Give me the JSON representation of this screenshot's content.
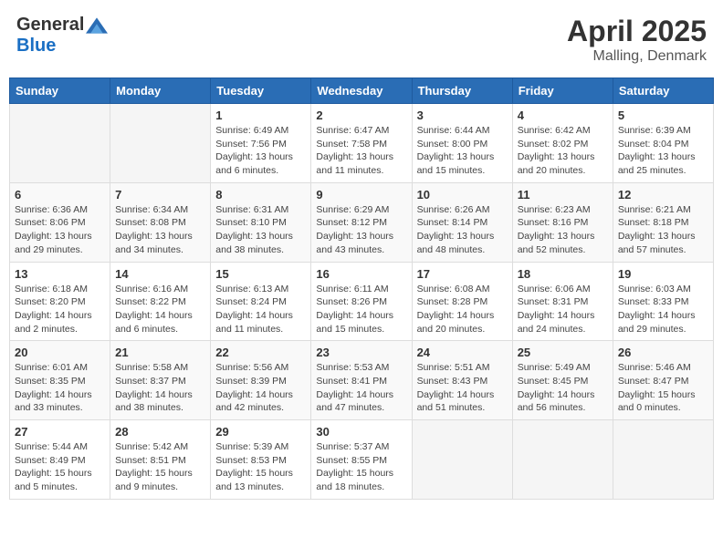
{
  "header": {
    "logo_general": "General",
    "logo_blue": "Blue",
    "month_year": "April 2025",
    "location": "Malling, Denmark"
  },
  "days_of_week": [
    "Sunday",
    "Monday",
    "Tuesday",
    "Wednesday",
    "Thursday",
    "Friday",
    "Saturday"
  ],
  "weeks": [
    [
      {
        "day": "",
        "info": ""
      },
      {
        "day": "",
        "info": ""
      },
      {
        "day": "1",
        "info": "Sunrise: 6:49 AM\nSunset: 7:56 PM\nDaylight: 13 hours and 6 minutes."
      },
      {
        "day": "2",
        "info": "Sunrise: 6:47 AM\nSunset: 7:58 PM\nDaylight: 13 hours and 11 minutes."
      },
      {
        "day": "3",
        "info": "Sunrise: 6:44 AM\nSunset: 8:00 PM\nDaylight: 13 hours and 15 minutes."
      },
      {
        "day": "4",
        "info": "Sunrise: 6:42 AM\nSunset: 8:02 PM\nDaylight: 13 hours and 20 minutes."
      },
      {
        "day": "5",
        "info": "Sunrise: 6:39 AM\nSunset: 8:04 PM\nDaylight: 13 hours and 25 minutes."
      }
    ],
    [
      {
        "day": "6",
        "info": "Sunrise: 6:36 AM\nSunset: 8:06 PM\nDaylight: 13 hours and 29 minutes."
      },
      {
        "day": "7",
        "info": "Sunrise: 6:34 AM\nSunset: 8:08 PM\nDaylight: 13 hours and 34 minutes."
      },
      {
        "day": "8",
        "info": "Sunrise: 6:31 AM\nSunset: 8:10 PM\nDaylight: 13 hours and 38 minutes."
      },
      {
        "day": "9",
        "info": "Sunrise: 6:29 AM\nSunset: 8:12 PM\nDaylight: 13 hours and 43 minutes."
      },
      {
        "day": "10",
        "info": "Sunrise: 6:26 AM\nSunset: 8:14 PM\nDaylight: 13 hours and 48 minutes."
      },
      {
        "day": "11",
        "info": "Sunrise: 6:23 AM\nSunset: 8:16 PM\nDaylight: 13 hours and 52 minutes."
      },
      {
        "day": "12",
        "info": "Sunrise: 6:21 AM\nSunset: 8:18 PM\nDaylight: 13 hours and 57 minutes."
      }
    ],
    [
      {
        "day": "13",
        "info": "Sunrise: 6:18 AM\nSunset: 8:20 PM\nDaylight: 14 hours and 2 minutes."
      },
      {
        "day": "14",
        "info": "Sunrise: 6:16 AM\nSunset: 8:22 PM\nDaylight: 14 hours and 6 minutes."
      },
      {
        "day": "15",
        "info": "Sunrise: 6:13 AM\nSunset: 8:24 PM\nDaylight: 14 hours and 11 minutes."
      },
      {
        "day": "16",
        "info": "Sunrise: 6:11 AM\nSunset: 8:26 PM\nDaylight: 14 hours and 15 minutes."
      },
      {
        "day": "17",
        "info": "Sunrise: 6:08 AM\nSunset: 8:28 PM\nDaylight: 14 hours and 20 minutes."
      },
      {
        "day": "18",
        "info": "Sunrise: 6:06 AM\nSunset: 8:31 PM\nDaylight: 14 hours and 24 minutes."
      },
      {
        "day": "19",
        "info": "Sunrise: 6:03 AM\nSunset: 8:33 PM\nDaylight: 14 hours and 29 minutes."
      }
    ],
    [
      {
        "day": "20",
        "info": "Sunrise: 6:01 AM\nSunset: 8:35 PM\nDaylight: 14 hours and 33 minutes."
      },
      {
        "day": "21",
        "info": "Sunrise: 5:58 AM\nSunset: 8:37 PM\nDaylight: 14 hours and 38 minutes."
      },
      {
        "day": "22",
        "info": "Sunrise: 5:56 AM\nSunset: 8:39 PM\nDaylight: 14 hours and 42 minutes."
      },
      {
        "day": "23",
        "info": "Sunrise: 5:53 AM\nSunset: 8:41 PM\nDaylight: 14 hours and 47 minutes."
      },
      {
        "day": "24",
        "info": "Sunrise: 5:51 AM\nSunset: 8:43 PM\nDaylight: 14 hours and 51 minutes."
      },
      {
        "day": "25",
        "info": "Sunrise: 5:49 AM\nSunset: 8:45 PM\nDaylight: 14 hours and 56 minutes."
      },
      {
        "day": "26",
        "info": "Sunrise: 5:46 AM\nSunset: 8:47 PM\nDaylight: 15 hours and 0 minutes."
      }
    ],
    [
      {
        "day": "27",
        "info": "Sunrise: 5:44 AM\nSunset: 8:49 PM\nDaylight: 15 hours and 5 minutes."
      },
      {
        "day": "28",
        "info": "Sunrise: 5:42 AM\nSunset: 8:51 PM\nDaylight: 15 hours and 9 minutes."
      },
      {
        "day": "29",
        "info": "Sunrise: 5:39 AM\nSunset: 8:53 PM\nDaylight: 15 hours and 13 minutes."
      },
      {
        "day": "30",
        "info": "Sunrise: 5:37 AM\nSunset: 8:55 PM\nDaylight: 15 hours and 18 minutes."
      },
      {
        "day": "",
        "info": ""
      },
      {
        "day": "",
        "info": ""
      },
      {
        "day": "",
        "info": ""
      }
    ]
  ]
}
